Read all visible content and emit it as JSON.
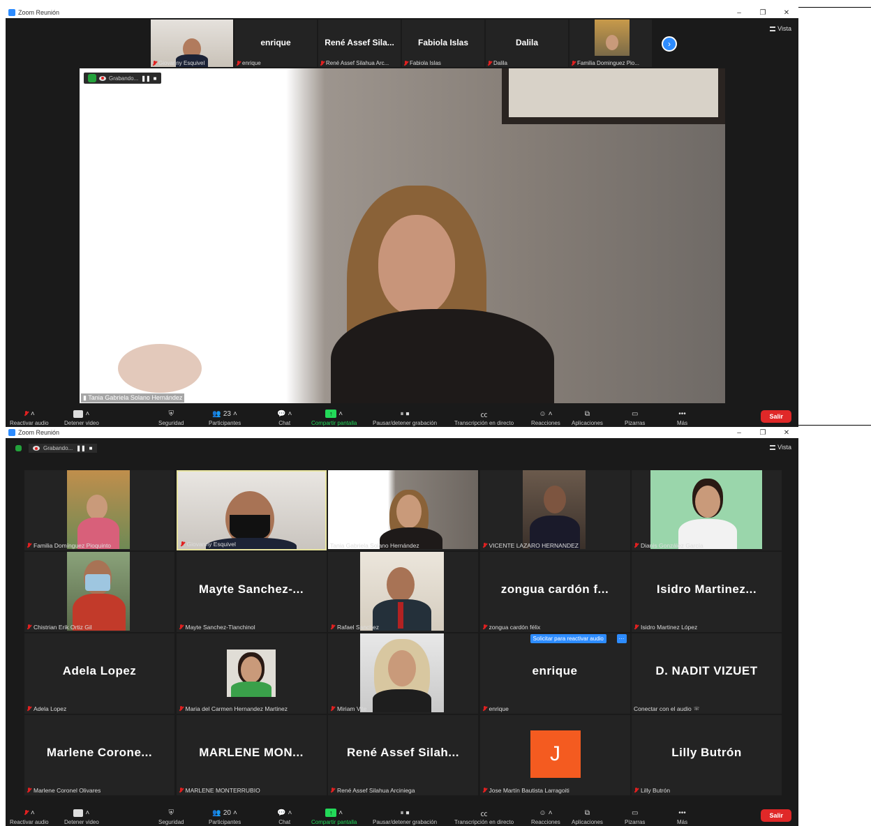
{
  "windows": [
    {
      "title": "Zoom Reunión",
      "vista": "Vista",
      "recording": "Grabando...",
      "thumbnails": [
        {
          "big": "",
          "label": "Giovanny Esquivel"
        },
        {
          "big": "enrique",
          "label": "enrique"
        },
        {
          "big": "René Assef Sila...",
          "label": "René Assef Silahua Arc..."
        },
        {
          "big": "Fabiola Islas",
          "label": "Fabiola Islas"
        },
        {
          "big": "Dalila",
          "label": "Dalila"
        },
        {
          "big": "",
          "label": "Familia Dominguez Pio..."
        }
      ],
      "speaker": "Tania Gabriela Solano Hernández",
      "participants_count": "23"
    },
    {
      "title": "Zoom Reunión",
      "vista": "Vista",
      "recording": "Grabando...",
      "participants_count": "20",
      "tiles": [
        {
          "big": "",
          "label": "Familia Domínguez Pioquinto"
        },
        {
          "big": "",
          "label": "Giovanny Esquivel"
        },
        {
          "big": "",
          "label": "Tania Gabriela Solano Hernández"
        },
        {
          "big": "",
          "label": "VICENTE LAZARO HERNANDEZ"
        },
        {
          "big": "",
          "label": "Dianis González García"
        },
        {
          "big": "",
          "label": "Chistrian Erik Ortiz Gil"
        },
        {
          "big": "Mayte Sanchez-...",
          "label": "Mayte Sanchez-Tlanchinol"
        },
        {
          "big": "",
          "label": "Rafael Sanchez"
        },
        {
          "big": "zongua cardón f...",
          "label": "zongua cardón félix"
        },
        {
          "big": "Isidro Martinez...",
          "label": "Isidro Martinez López"
        },
        {
          "big": "Adela Lopez",
          "label": "Adela Lopez"
        },
        {
          "big": "",
          "label": "Maria del Carmen Hernandez Martinez"
        },
        {
          "big": "",
          "label": "Miriam Vite"
        },
        {
          "big": "enrique",
          "label": "enrique"
        },
        {
          "big": "D. NADIT VIZUET",
          "label": "Conectar con el audio"
        },
        {
          "big": "Marlene Corone...",
          "label": "Marlene Coronel Olivares"
        },
        {
          "big": "MARLENE MON...",
          "label": "MARLENE MONTERRUBIO"
        },
        {
          "big": "René Assef Silah...",
          "label": "René Assef Silahua Arciniega"
        },
        {
          "big": "J",
          "label": "Jose Martín Bautista Larragoiti"
        },
        {
          "big": "Lilly Butrón",
          "label": "Lilly Butrón"
        }
      ],
      "solicitar": "Solicitar para reactivar audio"
    }
  ],
  "toolbar": {
    "reactivar_audio": "Reactivar audio",
    "detener_video": "Detener video",
    "seguridad": "Seguridad",
    "participantes": "Participantes",
    "chat": "Chat",
    "compartir": "Compartir pantalla",
    "pausar": "Pausar/detener grabación",
    "transcripcion": "Transcripción en directo",
    "reacciones": "Reacciones",
    "aplicaciones": "Aplicaciones",
    "pizarras": "Pizarras",
    "mas": "Más",
    "salir": "Salir"
  },
  "colors": {
    "accent_blue": "#2d8cff",
    "green": "#23d959",
    "red": "#e02828",
    "tile_bg": "#232323",
    "j_avatar": "#f45b20"
  }
}
